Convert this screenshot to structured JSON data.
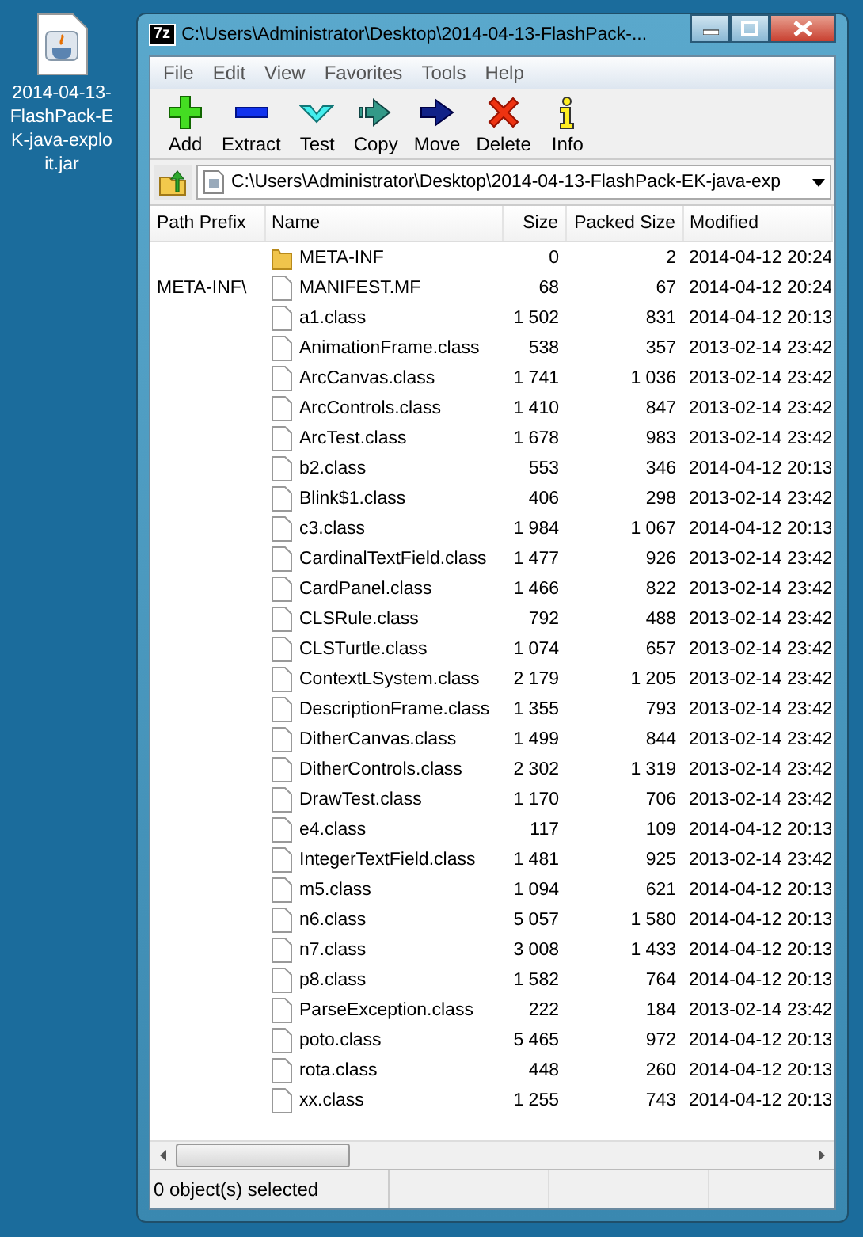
{
  "desktop_icon": {
    "label": "2014-04-13-FlashPack-EK-java-exploit.jar"
  },
  "window": {
    "app_icon": "7z",
    "title": "C:\\Users\\Administrator\\Desktop\\2014-04-13-FlashPack-..."
  },
  "menu": [
    "File",
    "Edit",
    "View",
    "Favorites",
    "Tools",
    "Help"
  ],
  "toolbar": [
    {
      "kind": "add",
      "label": "Add"
    },
    {
      "kind": "extract",
      "label": "Extract"
    },
    {
      "kind": "test",
      "label": "Test"
    },
    {
      "kind": "copy",
      "label": "Copy"
    },
    {
      "kind": "move",
      "label": "Move"
    },
    {
      "kind": "delete",
      "label": "Delete"
    },
    {
      "kind": "info",
      "label": "Info"
    }
  ],
  "address": {
    "value": "C:\\Users\\Administrator\\Desktop\\2014-04-13-FlashPack-EK-java-exp"
  },
  "table": {
    "columns": [
      "Path Prefix",
      "Name",
      "Size",
      "Packed Size",
      "Modified"
    ],
    "rows": [
      {
        "kind": "folder",
        "name": "META-INF",
        "size": "0",
        "packed": "2",
        "modified": "2014-04-12 20:24"
      },
      {
        "kind": "file",
        "prefix": "META-INF\\",
        "name": "MANIFEST.MF",
        "size": "68",
        "packed": "67",
        "modified": "2014-04-12 20:24"
      },
      {
        "kind": "file",
        "name": "a1.class",
        "size": "1 502",
        "packed": "831",
        "modified": "2014-04-12 20:13"
      },
      {
        "kind": "file",
        "name": "AnimationFrame.class",
        "size": "538",
        "packed": "357",
        "modified": "2013-02-14 23:42"
      },
      {
        "kind": "file",
        "name": "ArcCanvas.class",
        "size": "1 741",
        "packed": "1 036",
        "modified": "2013-02-14 23:42"
      },
      {
        "kind": "file",
        "name": "ArcControls.class",
        "size": "1 410",
        "packed": "847",
        "modified": "2013-02-14 23:42"
      },
      {
        "kind": "file",
        "name": "ArcTest.class",
        "size": "1 678",
        "packed": "983",
        "modified": "2013-02-14 23:42"
      },
      {
        "kind": "file",
        "name": "b2.class",
        "size": "553",
        "packed": "346",
        "modified": "2014-04-12 20:13"
      },
      {
        "kind": "file",
        "name": "Blink$1.class",
        "size": "406",
        "packed": "298",
        "modified": "2013-02-14 23:42"
      },
      {
        "kind": "file",
        "name": "c3.class",
        "size": "1 984",
        "packed": "1 067",
        "modified": "2014-04-12 20:13"
      },
      {
        "kind": "file",
        "name": "CardinalTextField.class",
        "size": "1 477",
        "packed": "926",
        "modified": "2013-02-14 23:42"
      },
      {
        "kind": "file",
        "name": "CardPanel.class",
        "size": "1 466",
        "packed": "822",
        "modified": "2013-02-14 23:42"
      },
      {
        "kind": "file",
        "name": "CLSRule.class",
        "size": "792",
        "packed": "488",
        "modified": "2013-02-14 23:42"
      },
      {
        "kind": "file",
        "name": "CLSTurtle.class",
        "size": "1 074",
        "packed": "657",
        "modified": "2013-02-14 23:42"
      },
      {
        "kind": "file",
        "name": "ContextLSystem.class",
        "size": "2 179",
        "packed": "1 205",
        "modified": "2013-02-14 23:42"
      },
      {
        "kind": "file",
        "name": "DescriptionFrame.class",
        "size": "1 355",
        "packed": "793",
        "modified": "2013-02-14 23:42"
      },
      {
        "kind": "file",
        "name": "DitherCanvas.class",
        "size": "1 499",
        "packed": "844",
        "modified": "2013-02-14 23:42"
      },
      {
        "kind": "file",
        "name": "DitherControls.class",
        "size": "2 302",
        "packed": "1 319",
        "modified": "2013-02-14 23:42"
      },
      {
        "kind": "file",
        "name": "DrawTest.class",
        "size": "1 170",
        "packed": "706",
        "modified": "2013-02-14 23:42"
      },
      {
        "kind": "file",
        "name": "e4.class",
        "size": "117",
        "packed": "109",
        "modified": "2014-04-12 20:13"
      },
      {
        "kind": "file",
        "name": "IntegerTextField.class",
        "size": "1 481",
        "packed": "925",
        "modified": "2013-02-14 23:42"
      },
      {
        "kind": "file",
        "name": "m5.class",
        "size": "1 094",
        "packed": "621",
        "modified": "2014-04-12 20:13"
      },
      {
        "kind": "file",
        "name": "n6.class",
        "size": "5 057",
        "packed": "1 580",
        "modified": "2014-04-12 20:13"
      },
      {
        "kind": "file",
        "name": "n7.class",
        "size": "3 008",
        "packed": "1 433",
        "modified": "2014-04-12 20:13"
      },
      {
        "kind": "file",
        "name": "p8.class",
        "size": "1 582",
        "packed": "764",
        "modified": "2014-04-12 20:13"
      },
      {
        "kind": "file",
        "name": "ParseException.class",
        "size": "222",
        "packed": "184",
        "modified": "2013-02-14 23:42"
      },
      {
        "kind": "file",
        "name": "poto.class",
        "size": "5 465",
        "packed": "972",
        "modified": "2014-04-12 20:13"
      },
      {
        "kind": "file",
        "name": "rota.class",
        "size": "448",
        "packed": "260",
        "modified": "2014-04-12 20:13"
      },
      {
        "kind": "file",
        "name": "xx.class",
        "size": "1 255",
        "packed": "743",
        "modified": "2014-04-12 20:13"
      }
    ]
  },
  "status_bar": {
    "text": "0 object(s) selected"
  }
}
